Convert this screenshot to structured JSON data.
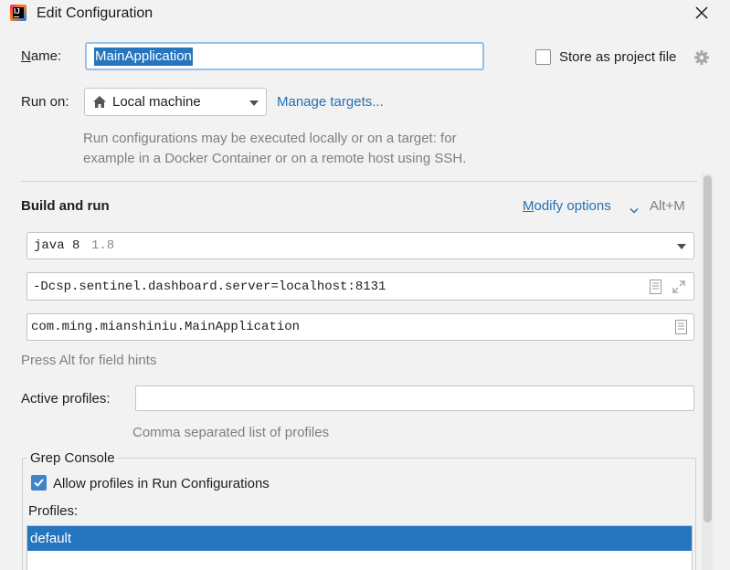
{
  "window": {
    "title": "Edit Configuration",
    "app_icon_label": "IJ"
  },
  "name_field": {
    "label": "Name:",
    "value": "MainApplication"
  },
  "store_as_project_file": {
    "label": "Store as project file",
    "checked": false
  },
  "run_on": {
    "label": "Run on:",
    "selected": "Local machine",
    "manage_link": "Manage targets...",
    "hint_line1": "Run configurations may be executed locally or on a target: for",
    "hint_line2": "example in a Docker Container or on a remote host using SSH."
  },
  "build_and_run": {
    "heading": "Build and run",
    "modify_options": "Modify options",
    "modify_shortcut": "Alt+M",
    "jdk_name": "java 8",
    "jdk_version": "1.8",
    "vm_options": "-Dcsp.sentinel.dashboard.server=localhost:8131",
    "main_class": "com.ming.mianshiniu.MainApplication",
    "field_hint": "Press Alt for field hints"
  },
  "active_profiles": {
    "label": "Active profiles:",
    "value": "",
    "hint": "Comma separated list of profiles"
  },
  "grep_console": {
    "legend": "Grep Console",
    "allow_profiles_label": "Allow profiles in Run Configurations",
    "allow_profiles_checked": true,
    "profiles_label": "Profiles:",
    "profiles": [
      "default"
    ],
    "selected_profile": "default"
  },
  "colors": {
    "accent": "#2675bf",
    "link": "#2470b3",
    "background": "#f2f2f2"
  }
}
